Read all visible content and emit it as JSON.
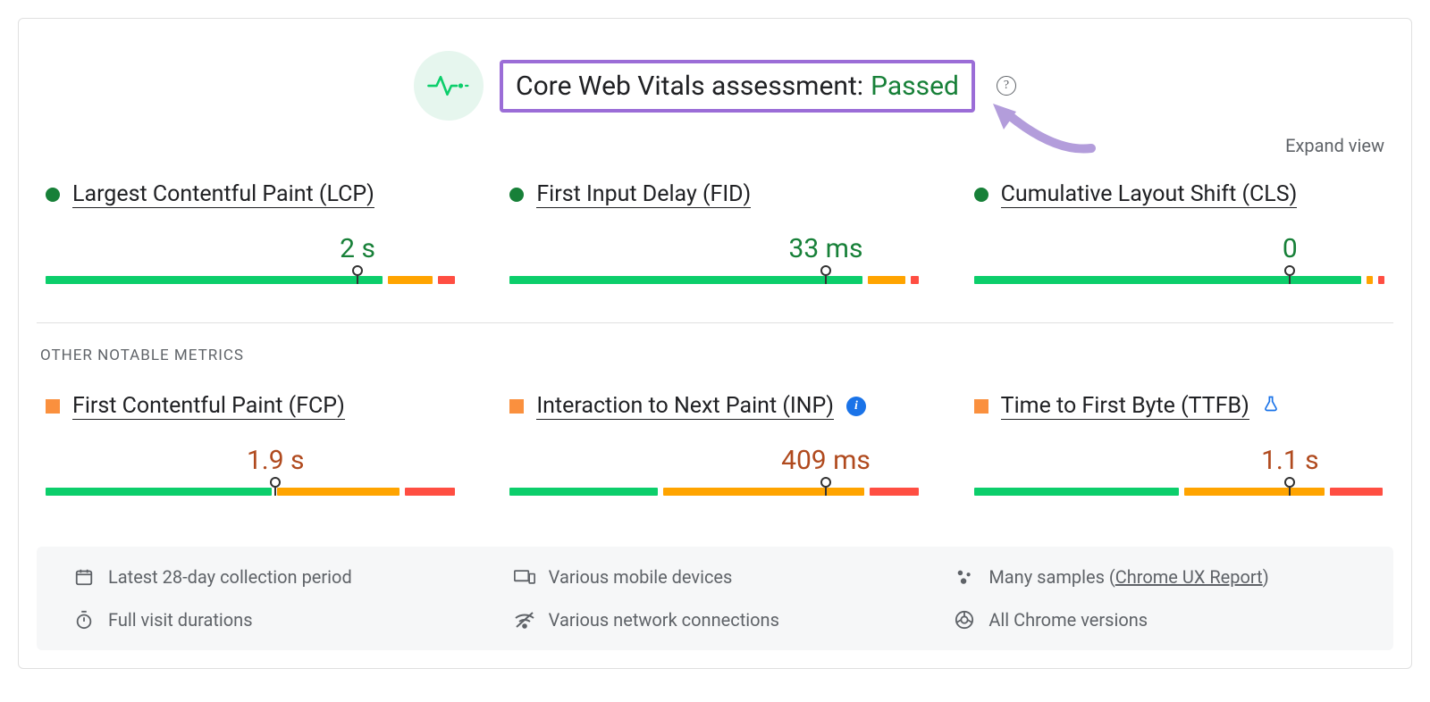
{
  "header": {
    "title_prefix": "Core Web Vitals assessment:",
    "status": "Passed",
    "expand_label": "Expand view"
  },
  "core_metrics": [
    {
      "name": "Largest Contentful Paint (LCP)",
      "status": "good",
      "value": "2 s",
      "value_color": "green",
      "marker_pct": 76,
      "segments": [
        {
          "color": "green",
          "pct": 82
        },
        {
          "color": "orange",
          "pct": 11
        },
        {
          "color": "red",
          "pct": 4
        }
      ]
    },
    {
      "name": "First Input Delay (FID)",
      "status": "good",
      "value": "33 ms",
      "value_color": "green",
      "marker_pct": 77,
      "segments": [
        {
          "color": "green",
          "pct": 86
        },
        {
          "color": "orange",
          "pct": 9
        },
        {
          "color": "red",
          "pct": 2
        }
      ]
    },
    {
      "name": "Cumulative Layout Shift (CLS)",
      "status": "good",
      "value": "0",
      "value_color": "green",
      "marker_pct": 77,
      "segments": [
        {
          "color": "green",
          "pct": 95
        },
        {
          "color": "orange",
          "pct": 1.5
        },
        {
          "color": "red",
          "pct": 1.5
        }
      ]
    }
  ],
  "other_section_title": "OTHER NOTABLE METRICS",
  "other_metrics": [
    {
      "name": "First Contentful Paint (FCP)",
      "status": "average",
      "value": "1.9 s",
      "value_color": "orange",
      "marker_pct": 56,
      "badges": [],
      "segments": [
        {
          "color": "green",
          "pct": 55
        },
        {
          "color": "orange",
          "pct": 30
        },
        {
          "color": "red",
          "pct": 12
        }
      ]
    },
    {
      "name": "Interaction to Next Paint (INP)",
      "status": "average",
      "value": "409 ms",
      "value_color": "orange",
      "marker_pct": 77,
      "badges": [
        "info"
      ],
      "segments": [
        {
          "color": "green",
          "pct": 36
        },
        {
          "color": "orange",
          "pct": 49
        },
        {
          "color": "red",
          "pct": 12
        }
      ]
    },
    {
      "name": "Time to First Byte (TTFB)",
      "status": "average",
      "value": "1.1 s",
      "value_color": "orange",
      "marker_pct": 77,
      "badges": [
        "flask"
      ],
      "segments": [
        {
          "color": "green",
          "pct": 50
        },
        {
          "color": "orange",
          "pct": 34
        },
        {
          "color": "red",
          "pct": 13
        }
      ]
    }
  ],
  "footer": {
    "items": [
      {
        "icon": "calendar",
        "text": "Latest 28-day collection period"
      },
      {
        "icon": "devices",
        "text": "Various mobile devices"
      },
      {
        "icon": "samples",
        "text_prefix": "Many samples (",
        "link": "Chrome UX Report",
        "text_suffix": ")"
      },
      {
        "icon": "timer",
        "text": "Full visit durations"
      },
      {
        "icon": "network",
        "text": "Various network connections"
      },
      {
        "icon": "chrome",
        "text": "All Chrome versions"
      }
    ]
  },
  "colors": {
    "good": "#0cce6b",
    "average": "#ffa400",
    "poor": "#ff4e42",
    "highlight_border": "#9b6dd7"
  }
}
